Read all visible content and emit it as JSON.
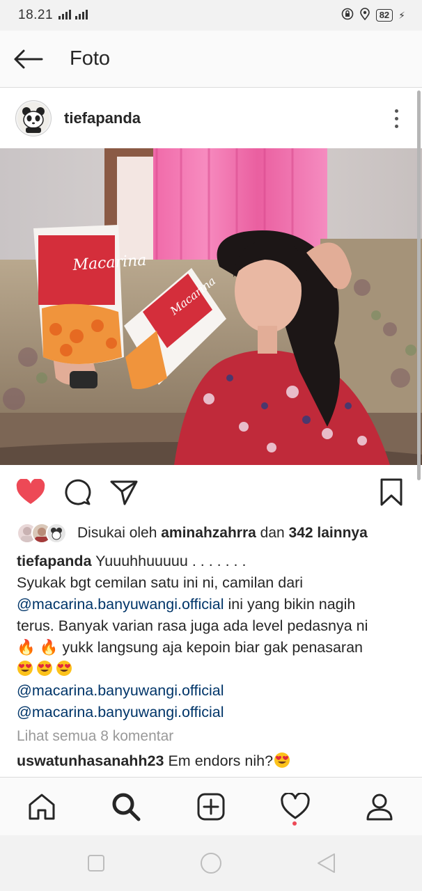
{
  "status_bar": {
    "time": "18.21",
    "signal": "4G H+",
    "battery": "82"
  },
  "header": {
    "title": "Foto"
  },
  "post": {
    "username": "tiefapanda",
    "likes": {
      "prefix": "Disukai oleh",
      "liker": "aminahzahrra",
      "conjunction": "dan",
      "others": "342 lainnya"
    },
    "caption": {
      "username": "tiefapanda",
      "line1": "Yuuuhhuuuuu . . . . . . .",
      "line2": "Syukak bgt cemilan satu ini ni, camilan dari",
      "mention1": "@macarina.banyuwangi.official",
      "line3_rest": " ini yang bikin nagih",
      "line4": "terus. Banyak varian rasa juga ada level pedasnya ni",
      "line5": " yukk langsung aja kepoin biar gak penasaran",
      "mention2": "@macarina.banyuwangi.official",
      "mention3": "@macarina.banyuwangi.official"
    },
    "view_comments": "Lihat semua 8 komentar",
    "comment": {
      "username": "uswatunhasanahh23",
      "text": "Em endors nih?"
    },
    "liked": true
  },
  "colors": {
    "like_red": "#ed4956",
    "mention_blue": "#003569",
    "muted_gray": "#999999"
  },
  "icons": [
    "back-arrow-icon",
    "more-options-icon",
    "heart-icon",
    "comment-icon",
    "share-icon",
    "bookmark-icon",
    "home-icon",
    "search-icon",
    "add-post-icon",
    "activity-icon",
    "profile-icon",
    "fire-emoji",
    "heart-eyes-emoji"
  ],
  "bottom_nav": [
    "home",
    "search",
    "add",
    "activity",
    "profile"
  ],
  "system_nav": [
    "recents",
    "home",
    "back"
  ]
}
